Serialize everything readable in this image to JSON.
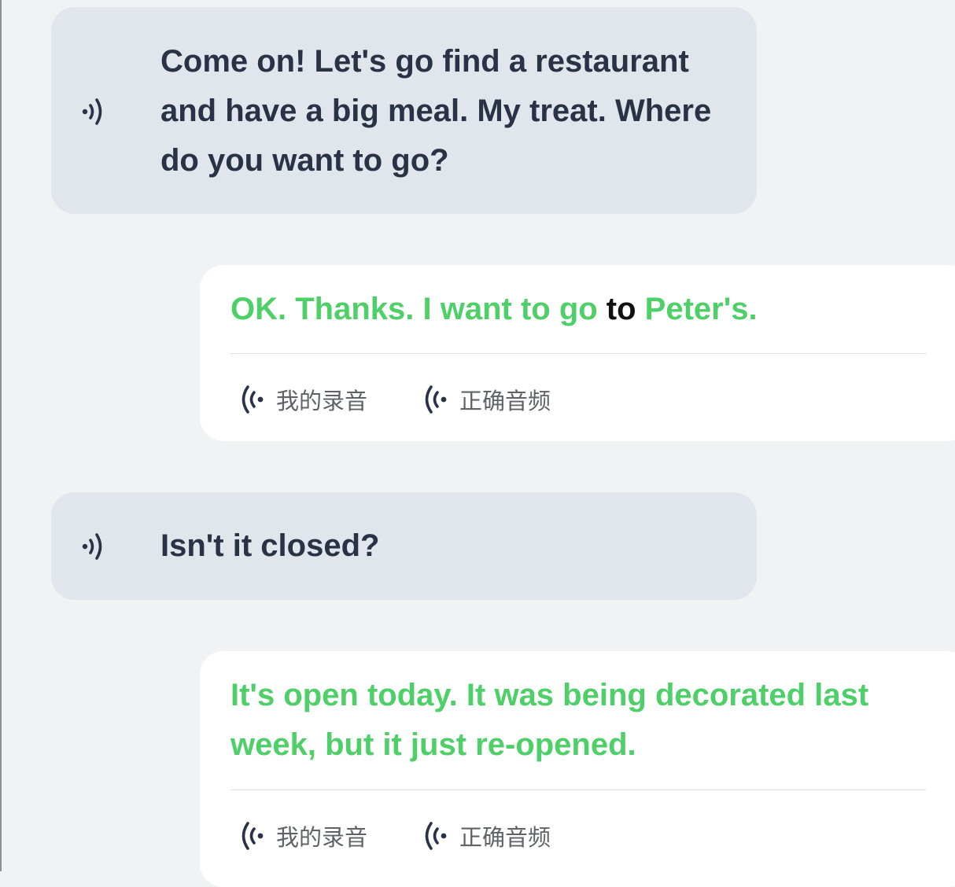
{
  "messages": [
    {
      "role": "partner",
      "text": "Come on! Let's go find a restaurant and have a big meal. My treat. Where do you want to go?"
    },
    {
      "role": "user",
      "segments": [
        {
          "text": "OK. Thanks. I want to go ",
          "status": "correct"
        },
        {
          "text": "to",
          "status": "wrong"
        },
        {
          "text": " Peter's.",
          "status": "correct"
        }
      ],
      "my_recording_label": "我的录音",
      "correct_audio_label": "正确音频"
    },
    {
      "role": "partner",
      "text": "Isn't it closed?"
    },
    {
      "role": "user",
      "text": "It's open today. It was being decorated last week, but it just re-opened.",
      "my_recording_label": "我的录音",
      "correct_audio_label": "正确音频"
    }
  ],
  "colors": {
    "correct_text": "#4fcf68",
    "wrong_text": "#111111",
    "partner_bubble": "#e1e5ec",
    "user_bubble": "#ffffff",
    "background": "#f1f2f4"
  },
  "icons": {
    "partner_play": "speaker-wave-icon",
    "audio_button": "sound-wave-icon"
  }
}
